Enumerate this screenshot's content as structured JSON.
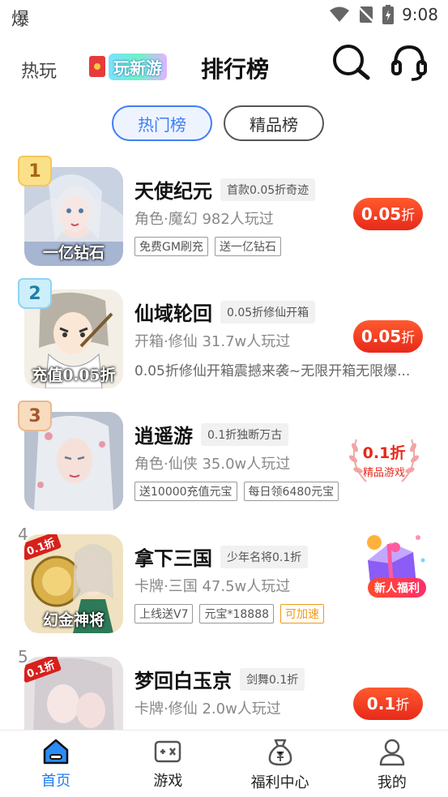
{
  "status_bar": {
    "left_glyph": "爆",
    "time": "9:08"
  },
  "header": {
    "tab_hot": "热玩",
    "tab_new": "玩新游",
    "tab_rank": "排行榜"
  },
  "segments": {
    "hot": "热门榜",
    "fine": "精品榜"
  },
  "games": [
    {
      "rank": "1",
      "name": "天使纪元",
      "promo": "首款0.05折奇迹",
      "meta": "角色·魔幻  982人玩过",
      "tags": [
        "免费GM刷充",
        "送一亿钻石"
      ],
      "icon_caption": "一亿钻石",
      "discount_value": "0.05",
      "discount_unit": "折"
    },
    {
      "rank": "2",
      "name": "仙域轮回",
      "promo": "0.05折修仙开箱",
      "meta": "开箱·修仙  31.7w人玩过",
      "desc": "0.05折修仙开箱震撼来袭~无限开箱无限爆...",
      "icon_caption": "充值0.05折",
      "discount_value": "0.05",
      "discount_unit": "折"
    },
    {
      "rank": "3",
      "name": "逍遥游",
      "promo": "0.1折独断万古",
      "meta": "角色·仙侠  35.0w人玩过",
      "tags": [
        "送10000充值元宝",
        "每日领6480元宝"
      ],
      "quality_value": "0.1折",
      "quality_label": "精品游戏"
    },
    {
      "rank": "4",
      "name": "拿下三国",
      "promo": "少年名将0.1折",
      "meta": "卡牌·三国  47.5w人玩过",
      "tags": [
        "上线送V7",
        "元宝*18888",
        "可加速"
      ],
      "icon_corner": "0.1折",
      "icon_caption": "幻金神将",
      "welfare_label": "新人福利"
    },
    {
      "rank": "5",
      "name": "梦回白玉京",
      "promo": "剑舞0.1折",
      "meta": "卡牌·修仙  2.0w人玩过",
      "icon_corner": "0.1折",
      "discount_value": "0.1",
      "discount_unit": "折"
    }
  ],
  "bottom_nav": [
    {
      "label": "首页",
      "icon": "home-icon",
      "active": true
    },
    {
      "label": "游戏",
      "icon": "gamepad-icon",
      "active": false
    },
    {
      "label": "福利中心",
      "icon": "money-bag-icon",
      "active": false
    },
    {
      "label": "我的",
      "icon": "user-icon",
      "active": false
    }
  ],
  "colors": {
    "accent_blue": "#3f7ef7",
    "nav_active": "#1e7cf0",
    "discount_red": "#e8291a"
  }
}
